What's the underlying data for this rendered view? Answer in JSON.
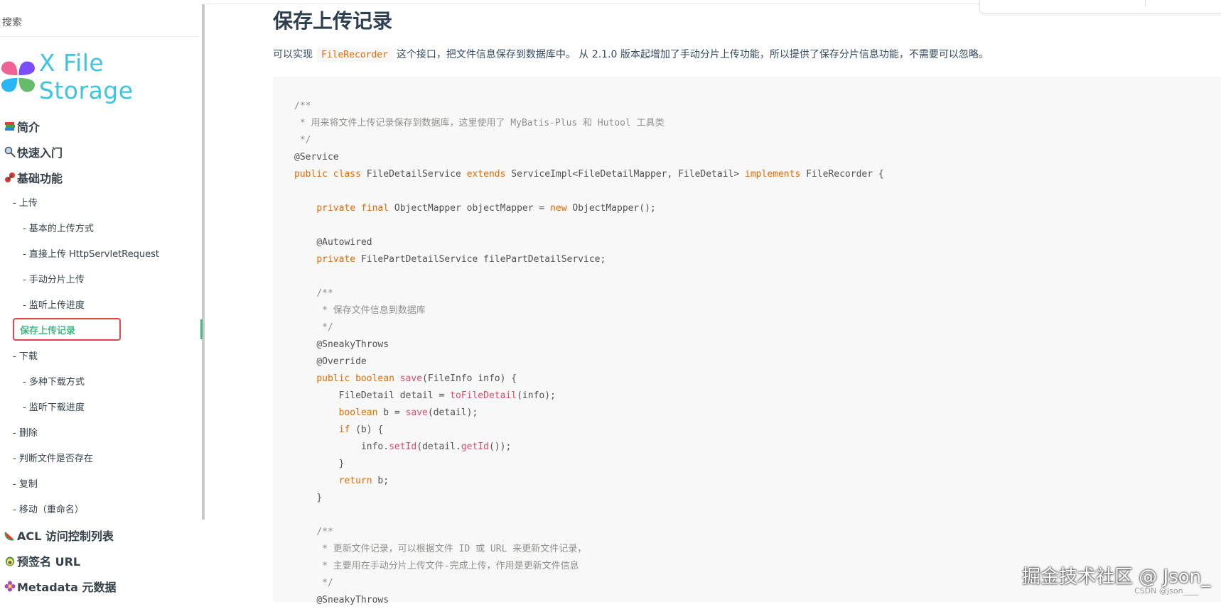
{
  "search": {
    "placeholder": "搜索"
  },
  "logo": {
    "text": "X File Storage"
  },
  "nav": {
    "intro": "简介",
    "quickstart": "快速入门",
    "basic": "基础功能",
    "upload": "- 上传",
    "upload_basic": "- 基本的上传方式",
    "upload_direct": "- 直接上传 HttpServletRequest",
    "upload_multipart": "- 手动分片上传",
    "upload_progress": "- 监听上传进度",
    "upload_record": "保存上传记录",
    "download": "- 下载",
    "download_multi": "- 多种下载方式",
    "download_progress": "- 监听下载进度",
    "delete": "- 删除",
    "exists": "- 判断文件是否存在",
    "copy": "- 复制",
    "move": "- 移动（重命名）",
    "acl": "ACL 访问控制列表",
    "presigned": "预签名 URL",
    "metadata": "Metadata 元数据"
  },
  "main": {
    "title": "保存上传记录",
    "intro_prefix": "可以实现",
    "intro_code": "FileRecorder",
    "intro_suffix": "这个接口，把文件信息保存到数据库中。 从 2.1.0 版本起增加了手动分片上传功能，所以提供了保存分片信息功能，不需要可以忽略。"
  },
  "code": {
    "c1": "/**",
    "c2": " * 用来将文件上传记录保存到数据库，这里使用了 MyBatis-Plus 和 Hutool 工具类",
    "c3": " */",
    "a_service": "@Service",
    "kw_public": "public",
    "kw_class": "class",
    "class_name": "FileDetailService",
    "kw_extends": "extends",
    "super": "ServiceImpl<FileDetailMapper, FileDetail>",
    "kw_implements": "implements",
    "iface": "FileRecorder {",
    "kw_private": "private",
    "kw_final": "final",
    "om_decl": "ObjectMapper objectMapper =",
    "kw_new": "new",
    "om_new": "ObjectMapper();",
    "a_autowired": "@Autowired",
    "fp_decl": "FilePartDetailService filePartDetailService;",
    "c4": "/**",
    "c5": " * 保存文件信息到数据库",
    "c6": " */",
    "a_sneaky": "@SneakyThrows",
    "a_override": "@Override",
    "kw_boolean": "boolean",
    "fn_save": "save",
    "save_args": "(FileInfo info) {",
    "detail_decl": "FileDetail detail =",
    "fn_toFileDetail": "toFileDetail",
    "detail_args": "(info);",
    "b_decl": "b =",
    "save_detail": "(detail);",
    "kw_if": "if",
    "if_cond": "(b) {",
    "info_prefix": "info.",
    "fn_setId": "setId",
    "setid_mid": "(detail.",
    "fn_getId": "getId",
    "setid_end": "());",
    "close_brace": "}",
    "kw_return": "return",
    "return_val": "b;",
    "c7": "/**",
    "c8": " * 更新文件记录，可以根据文件 ID 或 URL 来更新文件记录，",
    "c9": " * 主要用在手动分片上传文件-完成上传，作用是更新文件信息",
    "c10": " */",
    "a_sneaky2": "@SneakyThrows"
  },
  "watermark": {
    "text": "掘金技术社区 @ Json_",
    "csdn": "CSDN @Json____"
  },
  "colors": {
    "accent": "#42b983",
    "logo": "#3ec3e0",
    "keyword": "#e96900",
    "function": "#dd4a68",
    "highlight_box": "#e0464a"
  }
}
